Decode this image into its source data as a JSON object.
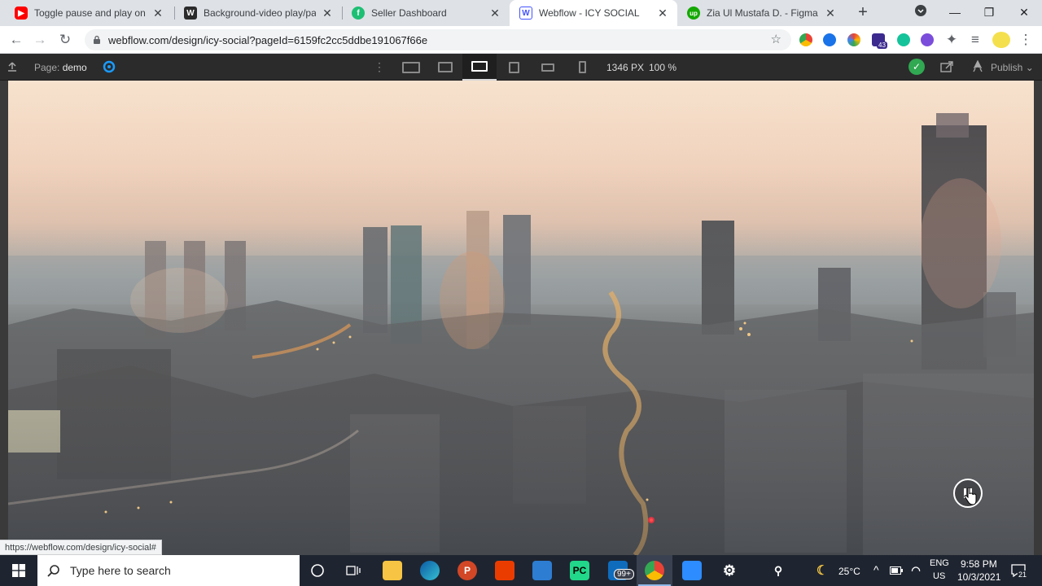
{
  "browser": {
    "tabs": [
      {
        "title": "Toggle pause and play on yo",
        "favicon": "youtube-icon",
        "color": "#ff0000"
      },
      {
        "title": "Background-video play/paus",
        "favicon": "webflow-w-icon",
        "color": "#2b2b2b"
      },
      {
        "title": "Seller Dashboard",
        "favicon": "fiverr-icon",
        "color": "#1dbf73"
      },
      {
        "title": "Webflow - ICY SOCIAL",
        "favicon": "webflow-icon",
        "color": "#4353ff"
      },
      {
        "title": "Zia Ul Mustafa D. - Figma to",
        "favicon": "upwork-icon",
        "color": "#14a800"
      }
    ],
    "url": "webflow.com/design/icy-social?pageId=6159fc2cc5ddbe191067f66e",
    "extension_badge": "43",
    "status_url": "https://webflow.com/design/icy-social#"
  },
  "designer": {
    "page_prefix": "Page:",
    "page_name": "demo",
    "width_px": "1346 PX",
    "zoom": "100 %",
    "publish_label": "Publish"
  },
  "taskbar": {
    "search_placeholder": "Type here to search",
    "mail_badge": "99+",
    "temperature": "25°C",
    "lang_top": "ENG",
    "lang_bottom": "US",
    "time": "9:58 PM",
    "date": "10/3/2021",
    "notification_count": "21"
  },
  "colors": {
    "webflow_blue": "#4353ff",
    "designer_bar": "#2b2b2b",
    "taskbar": "#1f2530"
  }
}
